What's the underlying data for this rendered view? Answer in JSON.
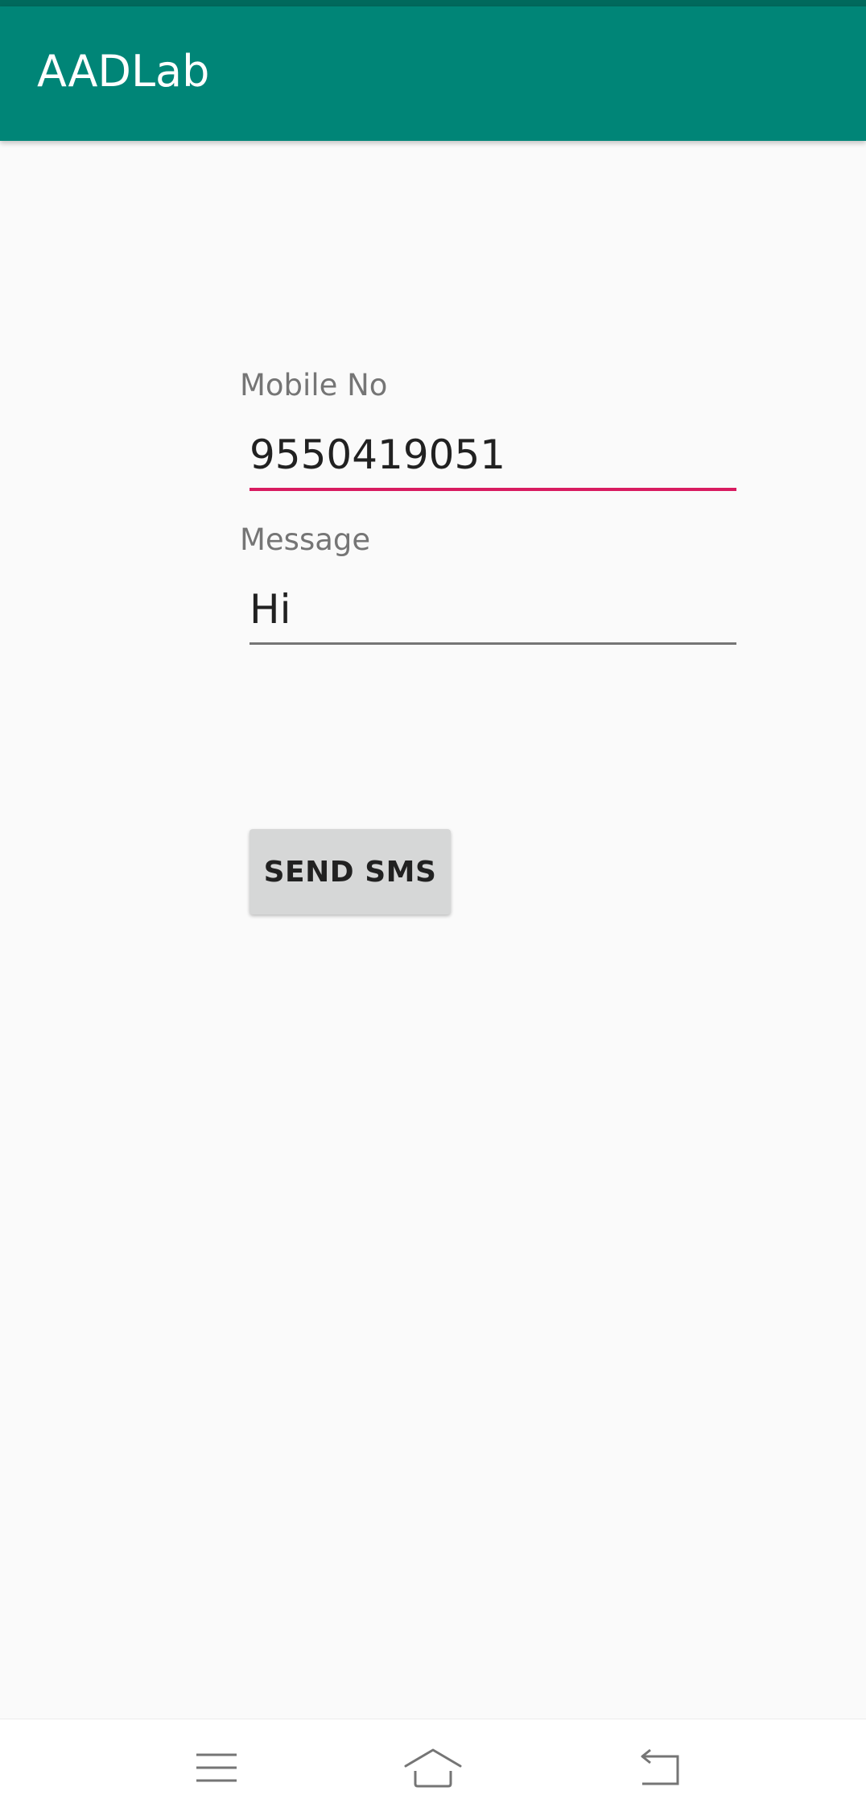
{
  "app_bar": {
    "title": "AADLab",
    "color": "#008577"
  },
  "form": {
    "mobile_label": "Mobile No",
    "mobile_value": "9550419051",
    "message_label": "Message",
    "message_value": "Hi",
    "send_button_label": "SEND SMS",
    "focus_accent_color": "#d81b60"
  },
  "nav_bar": {
    "icons": [
      "menu-icon",
      "home-icon",
      "back-icon"
    ]
  }
}
